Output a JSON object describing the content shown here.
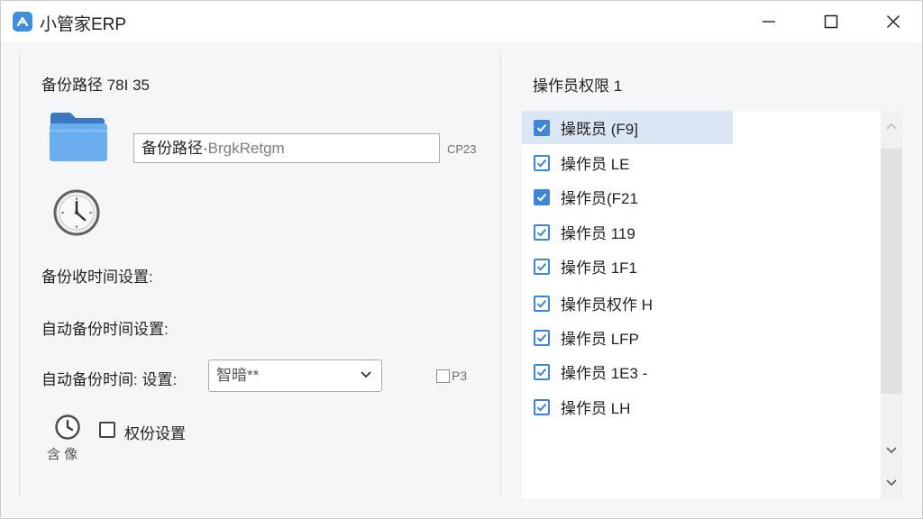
{
  "window": {
    "title": "小管家ERP",
    "icon": "app-logo-icon"
  },
  "left": {
    "backup_path_header": "备份路径 78I 35",
    "path_input_value": "备份路径·",
    "path_input_hint": "BrgkRetgm",
    "path_side_label": "CP23",
    "backup_time_setting": "备份收时间设置:",
    "auto_backup_time_setting": "自动备份时间设置:",
    "auto_backup_time_label": "自动备份时间: 设置:",
    "time_select_value": "智暗**",
    "p3_label": "P3",
    "permission_checkbox_label": "权份设置",
    "clock_caption": "含 像"
  },
  "right": {
    "header": "操作员权限 1",
    "items": [
      {
        "label": "操既员 (F9]",
        "checked": true,
        "style": "filled",
        "selected": true
      },
      {
        "label": "操作员 LE",
        "checked": true,
        "style": "outline",
        "selected": false
      },
      {
        "label": "操作员(F21",
        "checked": true,
        "style": "filled",
        "selected": false
      },
      {
        "label": "操作员 119",
        "checked": true,
        "style": "outline",
        "selected": false
      },
      {
        "label": "操作员 1F1",
        "checked": true,
        "style": "outline",
        "selected": false
      },
      {
        "label": "操作员权作 H",
        "checked": true,
        "style": "outline",
        "selected": false
      },
      {
        "label": "操作员 LFP",
        "checked": true,
        "style": "outline",
        "selected": false
      },
      {
        "label": "操作员 1E3 -",
        "checked": true,
        "style": "outline",
        "selected": false
      },
      {
        "label": "操作员 LH",
        "checked": true,
        "style": "outline",
        "selected": false
      }
    ]
  },
  "colors": {
    "accent": "#3f86d6",
    "selected_row": "#dbe7f5",
    "folder": "#5b9ee6"
  }
}
